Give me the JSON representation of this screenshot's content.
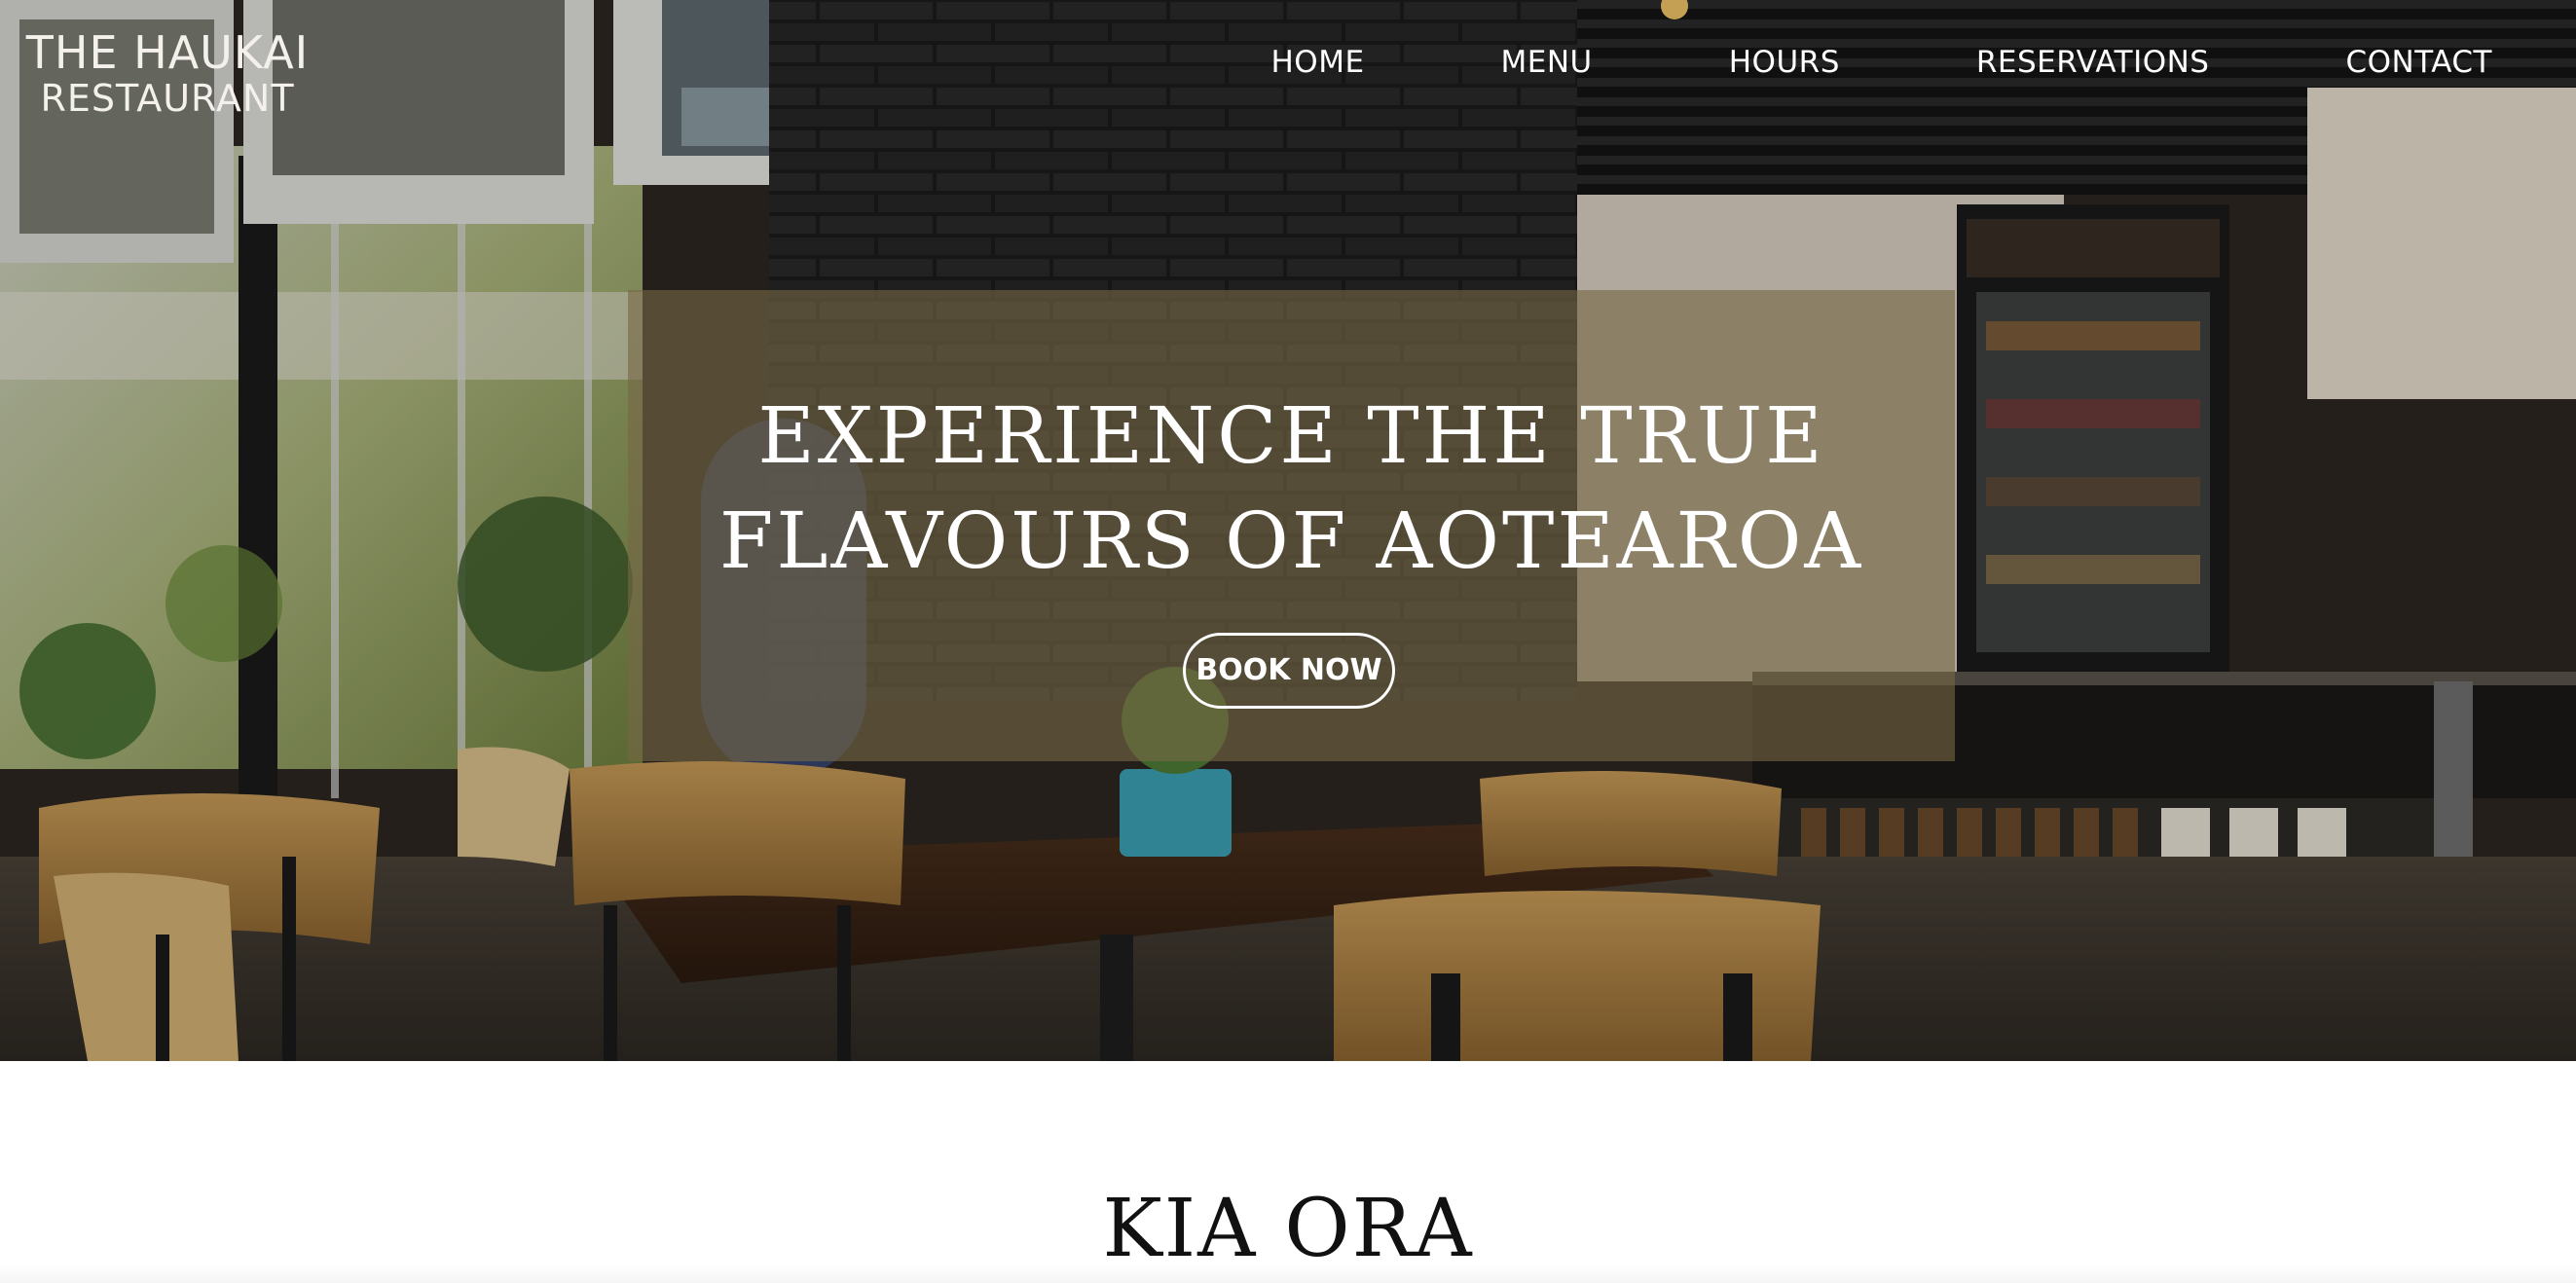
{
  "header": {
    "logo_line1": "THE HAUKAI",
    "logo_line2": "RESTAURANT",
    "nav": [
      {
        "label": "HOME"
      },
      {
        "label": "MENU"
      },
      {
        "label": "HOURS"
      },
      {
        "label": "RESERVATIONS"
      },
      {
        "label": "CONTACT"
      }
    ]
  },
  "hero": {
    "headline_line1": "EXPERIENCE THE TRUE",
    "headline_line2": "FLAVOURS OF AOTEAROA",
    "cta_label": "BOOK NOW"
  },
  "intro": {
    "title": "KIA ORA"
  },
  "colors": {
    "panel_overlay": "#766846",
    "text_light": "#ffffff",
    "heading_dark": "#111111"
  }
}
